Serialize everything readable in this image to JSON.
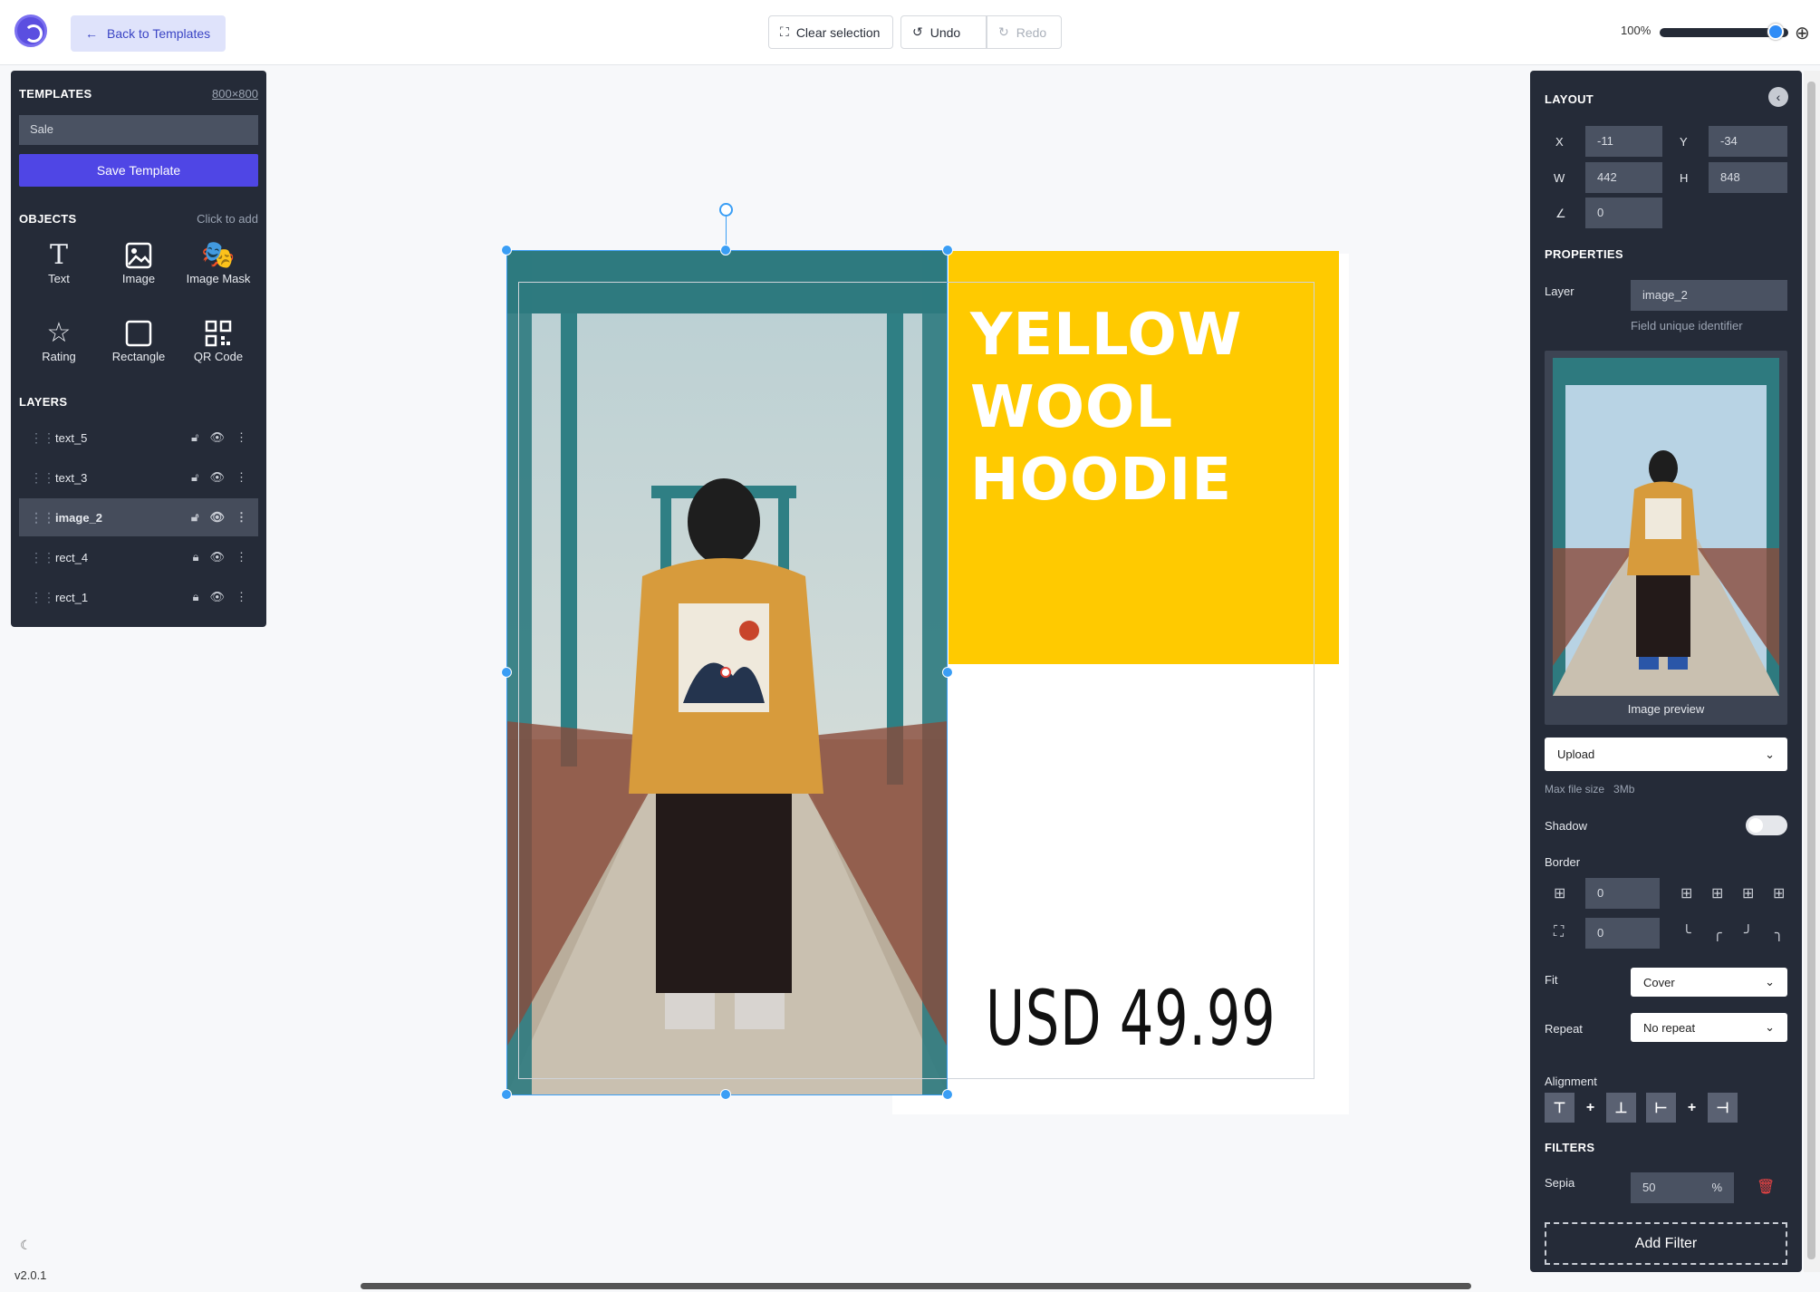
{
  "topbar": {
    "back_label": "Back to Templates",
    "clear_label": "Clear selection",
    "undo_label": "Undo",
    "redo_label": "Redo",
    "zoom_label": "100%",
    "zoom_level": 0.9
  },
  "left": {
    "templates_title": "TEMPLATES",
    "template_size": "800×800",
    "template_name": "Sale",
    "save_label": "Save Template",
    "objects_title": "OBJECTS",
    "objects_hint": "Click to add",
    "objects": [
      {
        "label": "Text",
        "icon": "text-icon"
      },
      {
        "label": "Image",
        "icon": "image-icon"
      },
      {
        "label": "Image Mask",
        "icon": "mask-icon"
      },
      {
        "label": "Rating",
        "icon": "star-icon"
      },
      {
        "label": "Rectangle",
        "icon": "rectangle-icon"
      },
      {
        "label": "QR Code",
        "icon": "qrcode-icon"
      }
    ],
    "layers_title": "LAYERS",
    "layers": [
      {
        "name": "text_5",
        "locked": false,
        "selected": false
      },
      {
        "name": "text_3",
        "locked": false,
        "selected": false
      },
      {
        "name": "image_2",
        "locked": false,
        "selected": true
      },
      {
        "name": "rect_4",
        "locked": true,
        "selected": false
      },
      {
        "name": "rect_1",
        "locked": true,
        "selected": false
      }
    ]
  },
  "canvas": {
    "headline_1": "YELLOW",
    "headline_2": "WOOL",
    "headline_3": "HOODIE",
    "price": "USD 49.99",
    "accent_color": "#ffca00"
  },
  "right": {
    "layout_title": "LAYOUT",
    "x_label": "X",
    "x_value": "-11",
    "y_label": "Y",
    "y_value": "-34",
    "w_label": "W",
    "w_value": "442",
    "h_label": "H",
    "h_value": "848",
    "angle_value": "0",
    "properties_title": "PROPERTIES",
    "layer_label": "Layer",
    "layer_value": "image_2",
    "layer_hint": "Field unique identifier",
    "preview_caption": "Image preview",
    "upload_label": "Upload",
    "max_size_label": "Max file size",
    "max_size_value": "3Mb",
    "shadow_label": "Shadow",
    "border_label": "Border",
    "border_width": "0",
    "border_radius": "0",
    "fit_label": "Fit",
    "fit_value": "Cover",
    "repeat_label": "Repeat",
    "repeat_value": "No repeat",
    "alignment_label": "Alignment",
    "filters_title": "FILTERS",
    "filter_name": "Sepia",
    "filter_value": "50",
    "filter_unit": "%",
    "add_filter_label": "Add Filter"
  },
  "footer": {
    "version": "v2.0.1"
  }
}
